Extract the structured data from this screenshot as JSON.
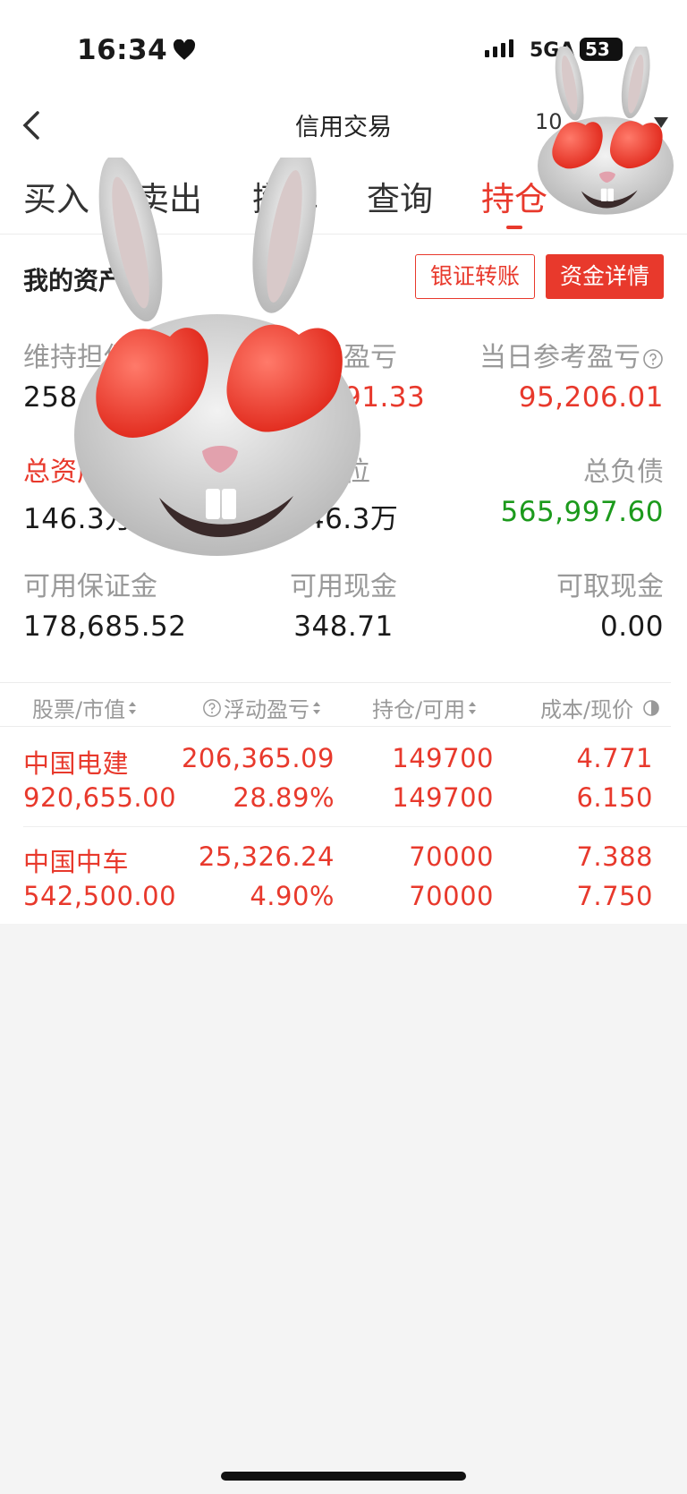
{
  "status_bar": {
    "time": "16:34",
    "network": "5GA",
    "battery": "53"
  },
  "nav": {
    "title": "信用交易",
    "account": "10"
  },
  "tabs": [
    {
      "label": "买入",
      "active": false
    },
    {
      "label": "卖出",
      "active": false
    },
    {
      "label": "撤单",
      "active": false
    },
    {
      "label": "查询",
      "active": false
    },
    {
      "label": "持仓",
      "active": true
    }
  ],
  "assets": {
    "title": "我的资产",
    "buttons": {
      "transfer": "银证转账",
      "details": "资金详情"
    },
    "metrics": {
      "maintenance_ratio": {
        "label": "维持担保比例",
        "value": "258.55%"
      },
      "floating_pnl": {
        "label": "参考盈亏",
        "value": "231,691.33"
      },
      "daily_pnl": {
        "label": "当日参考盈亏",
        "value": "95,206.01"
      },
      "total_assets": {
        "label": "总资产",
        "value": "146.3万"
      },
      "position_ratio": {
        "label": "仓位",
        "value": "146.3万"
      },
      "total_liabilities": {
        "label": "总负债",
        "value": "565,997.60"
      },
      "available_margin": {
        "label": "可用保证金",
        "value": "178,685.52"
      },
      "available_cash": {
        "label": "可用现金",
        "value": "348.71"
      },
      "withdrawable_cash": {
        "label": "可取现金",
        "value": "0.00"
      }
    }
  },
  "holdings": {
    "headers": {
      "stock": "股票/市值",
      "pnl": "浮动盈亏",
      "position": "持仓/可用",
      "cost": "成本/现价"
    },
    "rows": [
      {
        "name": "中国电建",
        "market_value": "920,655.00",
        "pnl": "206,365.09",
        "pnl_pct": "28.89%",
        "position": "149700",
        "available": "149700",
        "cost": "4.771",
        "price": "6.150"
      },
      {
        "name": "中国中车",
        "market_value": "542,500.00",
        "pnl": "25,326.24",
        "pnl_pct": "4.90%",
        "position": "70000",
        "available": "70000",
        "cost": "7.388",
        "price": "7.750"
      }
    ]
  },
  "colors": {
    "accent_red": "#e8392c",
    "loss_green": "#1c9a1c"
  },
  "stickers": [
    "heart-eyes-rabbit-sticker",
    "heart-eyes-rabbit-sticker"
  ]
}
